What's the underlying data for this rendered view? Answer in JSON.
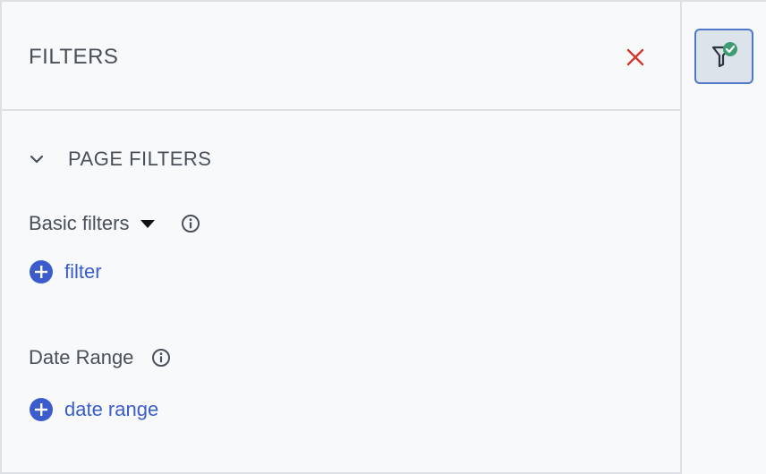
{
  "panel": {
    "title": "FILTERS",
    "close_icon": "close-x-icon",
    "close_color": "#d0392f"
  },
  "page_filters": {
    "section_title": "PAGE FILTERS",
    "toggle_icon": "chevron-down-icon",
    "basic_filters": {
      "label": "Basic filters",
      "caret_icon": "caret-down-icon",
      "info_icon": "info-icon",
      "add_label": "filter"
    },
    "date_range": {
      "label": "Date Range",
      "info_icon": "info-icon",
      "add_label": "date range"
    }
  },
  "sidebar": {
    "filter_button_icon": "filter-funnel-check-icon",
    "accent_color": "#4f78c8",
    "check_color": "#3e9c73"
  },
  "colors": {
    "link": "#3a5ccc",
    "text": "#48505a",
    "border": "#dde1e6"
  }
}
